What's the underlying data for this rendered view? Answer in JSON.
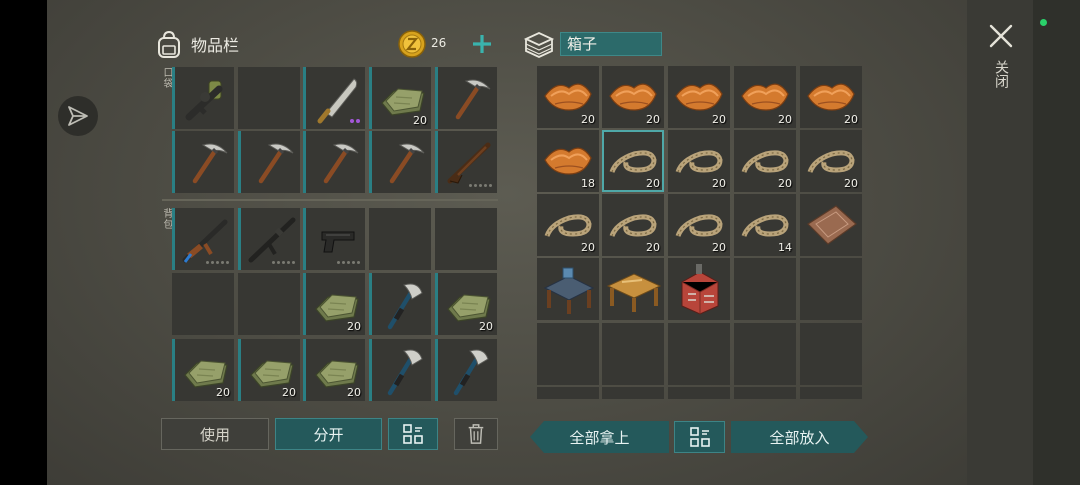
{
  "window": {
    "close_label": "关闭"
  },
  "inventory": {
    "title": "物品栏",
    "coins": "26",
    "pocket_label": "口袋",
    "backpack_label": "背包",
    "pocket": [
      {
        "item": "flamethrower-icon",
        "count": ""
      },
      {
        "item": "",
        "count": ""
      },
      {
        "item": "machete-icon",
        "count": "",
        "dots": "purple"
      },
      {
        "item": "cloth-icon",
        "count": "20"
      },
      {
        "item": "pickaxe-icon",
        "count": ""
      },
      {
        "item": "pickaxe-icon",
        "count": ""
      },
      {
        "item": "pickaxe-icon",
        "count": ""
      },
      {
        "item": "pickaxe-icon",
        "count": ""
      },
      {
        "item": "pickaxe-icon",
        "count": ""
      },
      {
        "item": "shotgun-icon",
        "count": "",
        "dots": "grey"
      }
    ],
    "backpack": [
      {
        "item": "ak-rifle-icon",
        "count": "",
        "dots": "grey"
      },
      {
        "item": "m16-rifle-icon",
        "count": "",
        "dots": "grey"
      },
      {
        "item": "pistol-icon",
        "count": "",
        "dots": "grey"
      },
      {
        "item": "",
        "count": ""
      },
      {
        "item": "",
        "count": ""
      },
      {
        "item": "",
        "count": ""
      },
      {
        "item": "",
        "count": ""
      },
      {
        "item": "cloth-icon",
        "count": "20"
      },
      {
        "item": "hatchet-icon",
        "count": ""
      },
      {
        "item": "cloth-icon",
        "count": "20"
      },
      {
        "item": "cloth-icon",
        "count": "20"
      },
      {
        "item": "cloth-icon",
        "count": "20"
      },
      {
        "item": "cloth-icon",
        "count": "20"
      },
      {
        "item": "hatchet-icon",
        "count": ""
      },
      {
        "item": "hatchet-icon",
        "count": ""
      }
    ],
    "buttons": {
      "use": "使用",
      "split": "分开"
    }
  },
  "box": {
    "name": "箱子",
    "slots": [
      {
        "item": "leather-icon",
        "count": "20"
      },
      {
        "item": "leather-icon",
        "count": "20"
      },
      {
        "item": "leather-icon",
        "count": "20"
      },
      {
        "item": "leather-icon",
        "count": "20"
      },
      {
        "item": "leather-icon",
        "count": "20"
      },
      {
        "item": "leather-icon",
        "count": "18"
      },
      {
        "item": "rope-icon",
        "count": "20",
        "selected": true
      },
      {
        "item": "rope-icon",
        "count": "20"
      },
      {
        "item": "rope-icon",
        "count": "20"
      },
      {
        "item": "rope-icon",
        "count": "20"
      },
      {
        "item": "rope-icon",
        "count": "20"
      },
      {
        "item": "rope-icon",
        "count": "20"
      },
      {
        "item": "rope-icon",
        "count": "20"
      },
      {
        "item": "rope-icon",
        "count": "14"
      },
      {
        "item": "welcome-mat-icon",
        "count": ""
      },
      {
        "item": "workbench-icon",
        "count": ""
      },
      {
        "item": "carpentry-table-icon",
        "count": ""
      },
      {
        "item": "furnace-icon",
        "count": ""
      },
      {
        "item": "",
        "count": ""
      },
      {
        "item": "",
        "count": ""
      },
      {
        "item": "",
        "count": ""
      },
      {
        "item": "",
        "count": ""
      },
      {
        "item": "",
        "count": ""
      },
      {
        "item": "",
        "count": ""
      },
      {
        "item": "",
        "count": ""
      }
    ],
    "buttons": {
      "take_all": "全部拿上",
      "put_all": "全部放入"
    }
  },
  "colors": {
    "accent_teal": "#24595b",
    "selected_outline": "#4fa8a8",
    "status_green": "#2ad16a"
  }
}
